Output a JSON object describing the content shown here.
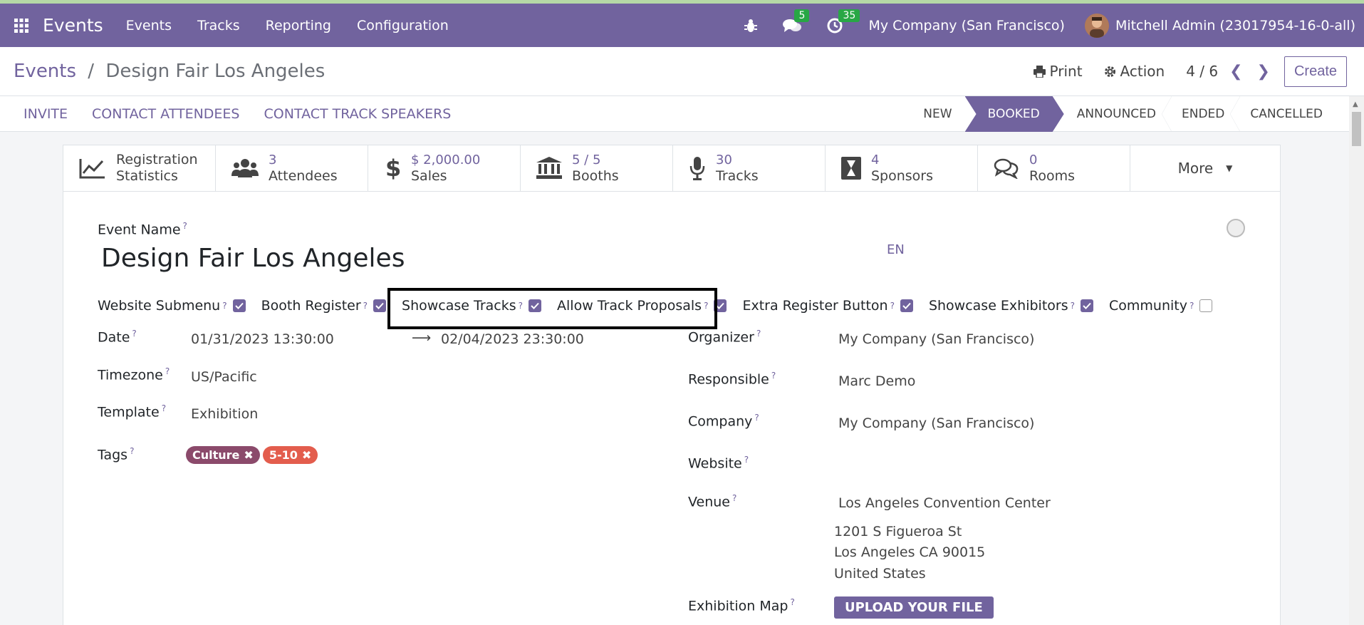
{
  "navbar": {
    "brand": "Events",
    "items": [
      "Events",
      "Tracks",
      "Reporting",
      "Configuration"
    ],
    "messages_count": "5",
    "activities_count": "35",
    "company": "My Company (San Francisco)",
    "user": "Mitchell Admin (23017954-16-0-all)"
  },
  "control": {
    "breadcrumb_parent": "Events",
    "breadcrumb_sep": "/",
    "breadcrumb_current": "Design Fair Los Angeles",
    "print": "Print",
    "action": "Action",
    "pager": "4 / 6",
    "create": "Create"
  },
  "statusbar": {
    "actions": [
      "INVITE",
      "CONTACT ATTENDEES",
      "CONTACT TRACK SPEAKERS"
    ],
    "stages": [
      "NEW",
      "BOOKED",
      "ANNOUNCED",
      "ENDED",
      "CANCELLED"
    ],
    "active_stage": "BOOKED"
  },
  "smart_buttons": {
    "registration": {
      "line1": "Registration",
      "line2": "Statistics"
    },
    "attendees": {
      "value": "3",
      "label": "Attendees"
    },
    "sales": {
      "value": "$ 2,000.00",
      "label": "Sales"
    },
    "booths": {
      "value": "5 / 5",
      "label": "Booths"
    },
    "tracks": {
      "value": "30",
      "label": "Tracks"
    },
    "sponsors": {
      "value": "4",
      "label": "Sponsors"
    },
    "rooms": {
      "value": "0",
      "label": "Rooms"
    },
    "more": "More"
  },
  "form": {
    "event_name_label": "Event Name",
    "event_name": "Design Fair Los Angeles",
    "lang": "EN",
    "checkboxes": {
      "website_submenu": {
        "label": "Website Submenu",
        "checked": true
      },
      "booth_register": {
        "label": "Booth Register",
        "checked": true
      },
      "showcase_tracks": {
        "label": "Showcase Tracks",
        "checked": true
      },
      "allow_track_proposals": {
        "label": "Allow Track Proposals",
        "checked": true
      },
      "extra_register_button": {
        "label": "Extra Register Button",
        "checked": true
      },
      "showcase_exhibitors": {
        "label": "Showcase Exhibitors",
        "checked": true
      },
      "community": {
        "label": "Community",
        "checked": false
      }
    },
    "date_label": "Date",
    "date_start": "01/31/2023 13:30:00",
    "date_end": "02/04/2023 23:30:00",
    "timezone_label": "Timezone",
    "timezone": "US/Pacific",
    "template_label": "Template",
    "template": "Exhibition",
    "tags_label": "Tags",
    "tags": [
      {
        "name": "Culture",
        "color": "#8b4a6b"
      },
      {
        "name": "5-10",
        "color": "#e35d4d"
      }
    ],
    "organizer_label": "Organizer",
    "organizer": "My Company (San Francisco)",
    "responsible_label": "Responsible",
    "responsible": "Marc Demo",
    "company_label": "Company",
    "company": "My Company (San Francisco)",
    "website_label": "Website",
    "venue_label": "Venue",
    "venue_name": "Los Angeles Convention Center",
    "venue_street": "1201 S Figueroa St",
    "venue_city": "Los Angeles CA 90015",
    "venue_country": "United States",
    "exhibition_map_label": "Exhibition Map",
    "upload_label": "UPLOAD YOUR FILE"
  },
  "colors": {
    "brand": "#71639e",
    "badge": "#28a745"
  }
}
